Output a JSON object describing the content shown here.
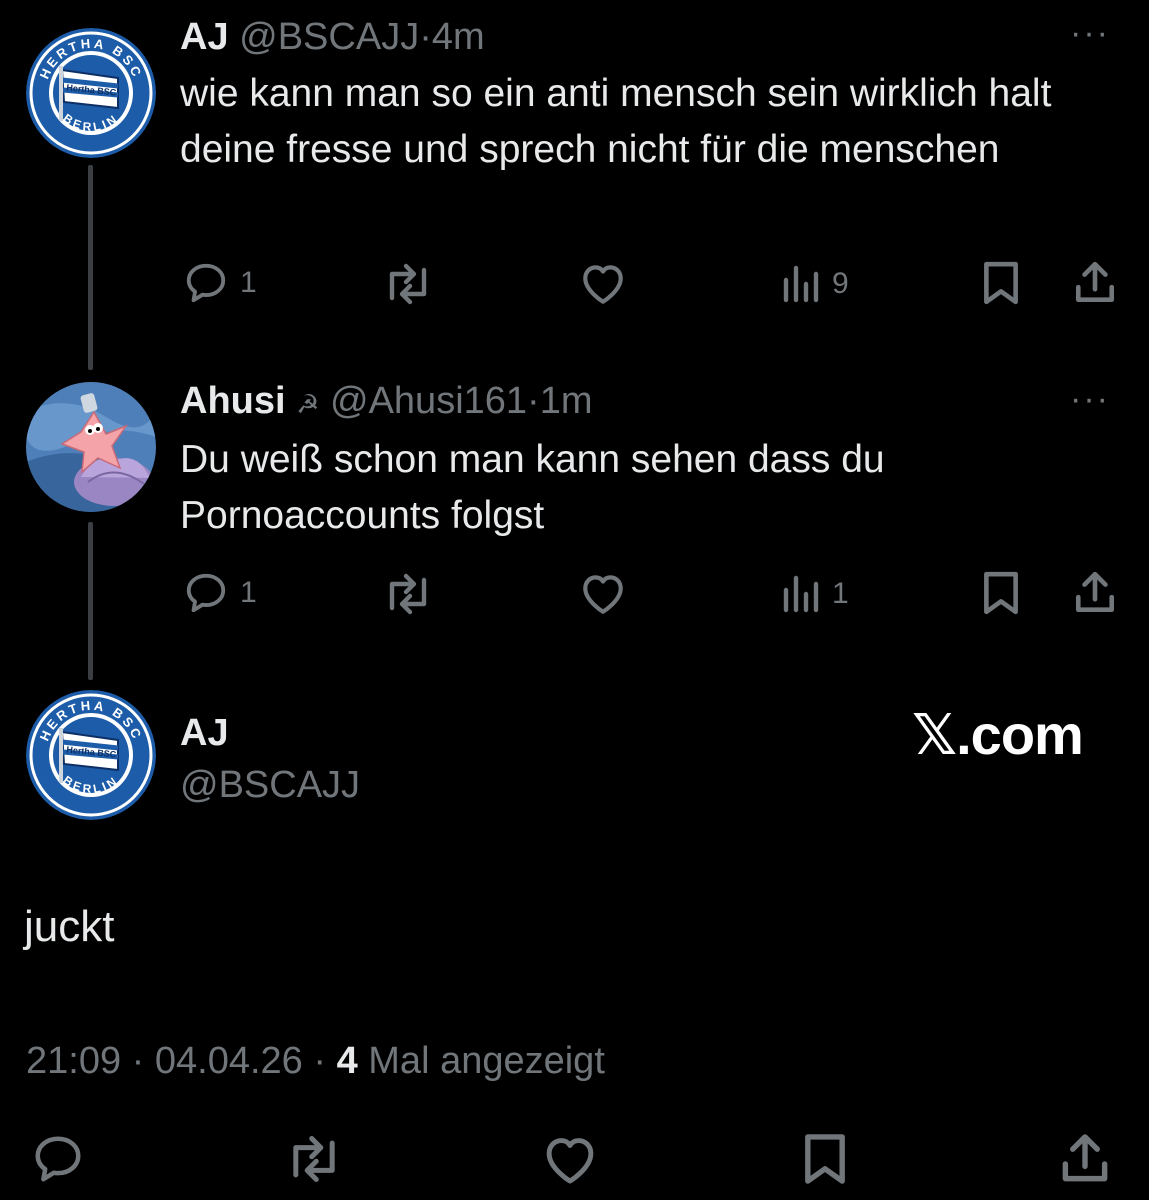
{
  "tweet1": {
    "name": "AJ",
    "handle": "@BSCAJJ",
    "dot": "·",
    "time": "4m",
    "text": "wie kann man so ein anti mensch sein wirklich halt deine fresse  und sprech nicht für die menschen",
    "replies": "1",
    "views": "9",
    "more": "···"
  },
  "tweet2": {
    "name": "Ahusi",
    "emoji": "☭",
    "handle": "@Ahusi161",
    "dot": "·",
    "time": "1m",
    "text": "Du weiß schon man kann sehen dass du Pornoaccounts folgst",
    "replies": "1",
    "views": "1",
    "more": "···"
  },
  "main": {
    "name": "AJ",
    "handle": "@BSCAJJ",
    "brand": "𝕏.com",
    "text": "juckt",
    "time": "21:09",
    "sep1": "·",
    "date": "04.04.26",
    "sep2": "·",
    "views_count": "4",
    "views_label": "Mal angezeigt"
  },
  "avatar": {
    "hertha_top": "HERTHA BSC",
    "hertha_bottom": "BERLIN",
    "flag_label": "Hertha BSC"
  },
  "colors": {
    "background": "#000000",
    "text": "#e7e9ea",
    "muted": "#71767b",
    "hertha_blue": "#1d5ca8"
  }
}
